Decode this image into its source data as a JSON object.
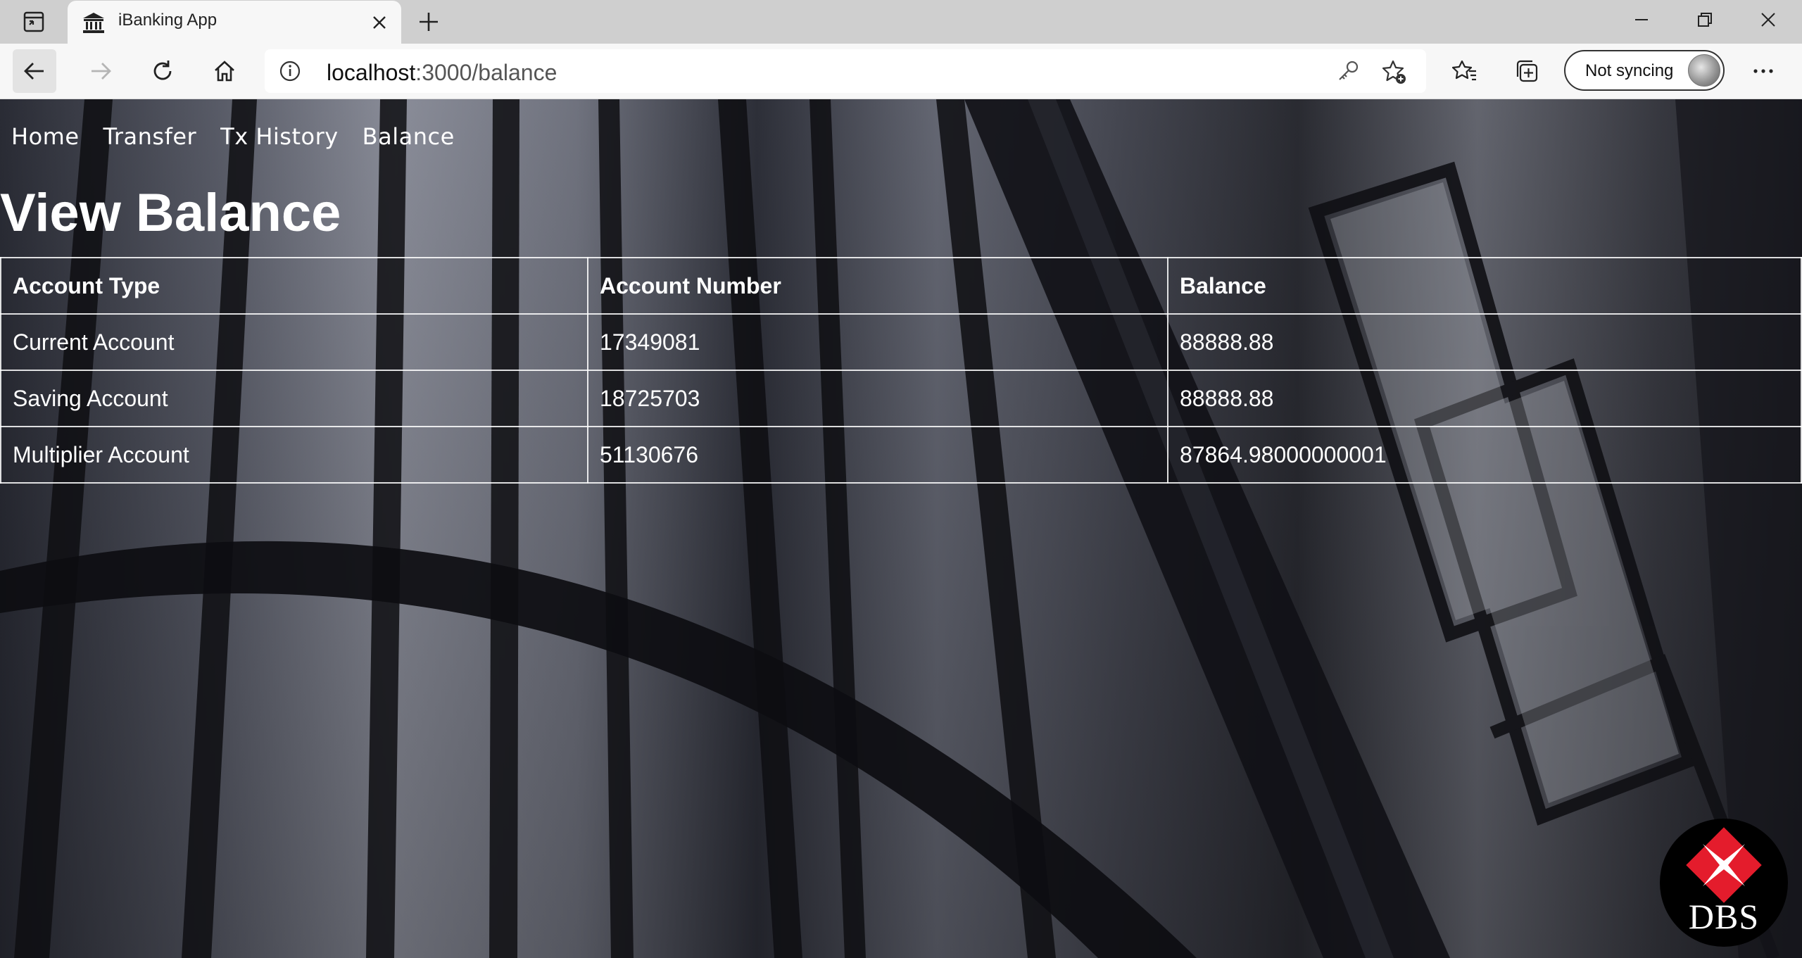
{
  "browser": {
    "tab": {
      "title": "iBanking App",
      "icon": "bank-icon"
    },
    "address": {
      "host": "localhost",
      "path": ":3000/balance"
    },
    "sync_label": "Not syncing"
  },
  "nav": {
    "items": [
      {
        "label": "Home"
      },
      {
        "label": "Transfer"
      },
      {
        "label": "Tx History"
      },
      {
        "label": "Balance"
      }
    ]
  },
  "page": {
    "title": "View Balance"
  },
  "table": {
    "headers": [
      "Account Type",
      "Account Number",
      "Balance"
    ],
    "rows": [
      [
        "Current Account",
        "17349081",
        "88888.88"
      ],
      [
        "Saving Account",
        "18725703",
        "88888.88"
      ],
      [
        "Multiplier Account",
        "51130676",
        "87864.98000000001"
      ]
    ]
  },
  "logo": {
    "text": "DBS",
    "accent_color": "#e41c2c"
  }
}
